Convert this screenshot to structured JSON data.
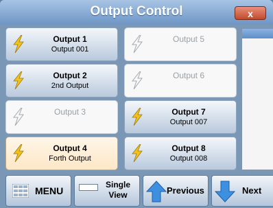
{
  "window": {
    "title": "Output Control",
    "close_label": "x"
  },
  "outputs": [
    {
      "name": "Output 1",
      "subtitle": "Output 001",
      "state": "on"
    },
    {
      "name": "Output 5",
      "subtitle": "",
      "state": "off"
    },
    {
      "name": "Output 2",
      "subtitle": "2nd Output",
      "state": "on"
    },
    {
      "name": "Output 6",
      "subtitle": "",
      "state": "off"
    },
    {
      "name": "Output 3",
      "subtitle": "",
      "state": "off"
    },
    {
      "name": "Output 7",
      "subtitle": "Output 007",
      "state": "on"
    },
    {
      "name": "Output 4",
      "subtitle": "Forth Output",
      "state": "selected"
    },
    {
      "name": "Output 8",
      "subtitle": "Output 008",
      "state": "on"
    }
  ],
  "toolbar": {
    "menu_label": "MENU",
    "single_view_line1": "Single",
    "single_view_line2": "View",
    "previous_label": "Previous",
    "next_label": "Next"
  },
  "colors": {
    "bolt_on": "#f2c21b",
    "bolt_off": "#b8bcc0",
    "title_bar": "#6d95c5",
    "close": "#c14a2e"
  },
  "icons": {
    "output": "lightning-bolt-icon",
    "menu": "keypad-icon",
    "previous": "arrow-up-icon",
    "next": "arrow-down-icon"
  }
}
